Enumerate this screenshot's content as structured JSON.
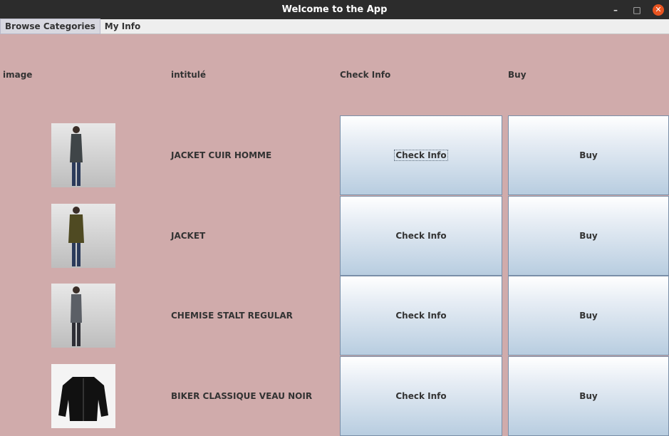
{
  "window": {
    "title": "Welcome to the App"
  },
  "window_controls": {
    "minimize": "–",
    "maximize": "□",
    "close": "✕"
  },
  "menu": {
    "items": [
      {
        "label": "Browse Categories"
      },
      {
        "label": "My Info"
      }
    ]
  },
  "table": {
    "headers": [
      "image",
      "intitulé",
      "Check Info",
      "Buy"
    ],
    "rows": [
      {
        "name": "JACKET CUIR HOMME",
        "check_label": "Check Info",
        "buy_label": "Buy",
        "image": "man-dark-jacket-photo"
      },
      {
        "name": "JACKET",
        "check_label": "Check Info",
        "buy_label": "Buy",
        "image": "man-olive-jacket-photo"
      },
      {
        "name": "CHEMISE STALT REGULAR",
        "check_label": "Check Info",
        "buy_label": "Buy",
        "image": "man-plaid-shirt-photo"
      },
      {
        "name": "BIKER CLASSIQUE VEAU NOIR",
        "check_label": "Check Info",
        "buy_label": "Buy",
        "image": "black-leather-biker-jacket-photo"
      }
    ]
  },
  "colors": {
    "background": "#d0abab",
    "titlebar": "#2c2c2c",
    "close_button": "#e95420",
    "button_border": "#7a8fa8"
  }
}
